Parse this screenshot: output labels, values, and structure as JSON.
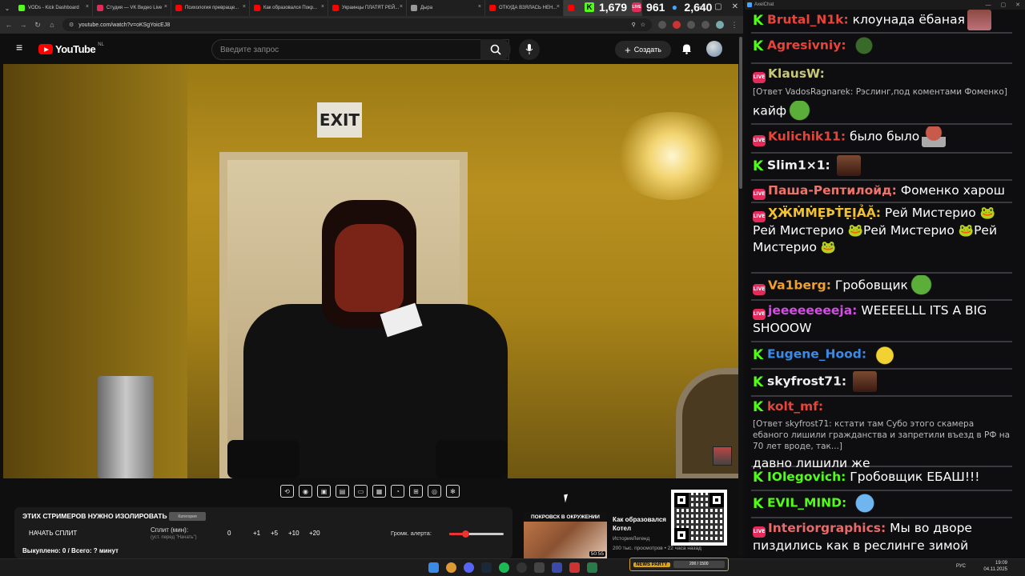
{
  "browser": {
    "tabs": [
      {
        "label": "VODs - Kick Dashboard",
        "color": "#53fc18",
        "active": false
      },
      {
        "label": "Студия — VK Видео Live",
        "color": "#e22b5b",
        "active": false
      },
      {
        "label": "Психология превраще...",
        "color": "#f00",
        "active": false
      },
      {
        "label": "Как образовался Покр...",
        "color": "#f00",
        "active": false
      },
      {
        "label": "Украинцы ПЛАТЯТ РЕЙ...",
        "color": "#f00",
        "active": false
      },
      {
        "label": "Дыра",
        "color": "#999",
        "active": false
      },
      {
        "label": "ОТКУДА ВЗЯЛАСЬ НЕН...",
        "color": "#f00",
        "active": false
      },
      {
        "label": "",
        "color": "#f00",
        "active": true
      }
    ],
    "url": "youtube.com/watch?v=oKSgYoicEJ8",
    "window_controls": [
      "—",
      "▢",
      "✕"
    ]
  },
  "stream_overlay": {
    "kick_viewers": "1,679",
    "vk_viewers": "961",
    "total_viewers": "2,640"
  },
  "youtube": {
    "logo_text": "YouTube",
    "region": "NL",
    "search_placeholder": "Введите запрос",
    "create_label": "Создать"
  },
  "video": {
    "exit_sign": "EXIT"
  },
  "player_toolbar": {
    "icons": [
      "loop-icon",
      "audio-icon",
      "screenshot-icon",
      "clapper-icon",
      "aspect-icon",
      "frame-icon",
      "speed-icon",
      "crop-icon",
      "camera-icon",
      "settings-icon"
    ]
  },
  "split_panel": {
    "title": "ЭТИХ СТРИМЕРОВ НУЖНО ИЗОЛИРОВАТЬ",
    "badge": "Категория",
    "start_label": "НАЧАТЬ СПЛИТ",
    "split_min_label": "Сплит (мин):",
    "split_hint": "(уст. перед \"Начать\")",
    "value": "0",
    "increments": [
      "+1",
      "+5",
      "+10",
      "+20"
    ],
    "volume_label": "Громк. алерта:",
    "volume_level": 0.3,
    "status": "Выкуплено: 0 / Всего: ? минут"
  },
  "recommended": {
    "thumb_title": "ПОКРОВСК В ОКРУЖЕНИИ",
    "duration": "50:55",
    "title": "Как образовался Котел",
    "channel": "ИсторияЛегенд",
    "meta": "200 тыс. просмотров • 22 часа назад"
  },
  "chat": {
    "window_title": "AxelChat",
    "messages": [
      {
        "platform": "kick",
        "user": "Brutal_N1k:",
        "color": "#e8443a",
        "text": "клоунада ёбаная",
        "emotes": [
          "e-mouth"
        ],
        "reply": ""
      },
      {
        "platform": "kick",
        "user": "Agresivniy:",
        "color": "#e8443a",
        "text": "",
        "emotes": [
          "e-frog"
        ],
        "reply": ""
      },
      {
        "platform": "vk",
        "user": "KlausW:",
        "color": "#c8c87a",
        "text": "кайф",
        "emotes": [
          "e-pepe"
        ],
        "reply": "[Ответ VadosRagnarek: Рэслинг,под коментами Фоменко]"
      },
      {
        "platform": "vk",
        "user": "Kulichik11:",
        "color": "#e8443a",
        "text": "было было",
        "emotes": [
          "e-mush"
        ],
        "reply": ""
      },
      {
        "platform": "kick",
        "user": "Slim1×1:",
        "color": "#f0f0f0",
        "text": "",
        "emotes": [
          "e-face"
        ],
        "reply": ""
      },
      {
        "platform": "vk",
        "user": "Паша-Рептилойд:",
        "color": "#f0736a",
        "text": "Фоменко харош",
        "emotes": [],
        "reply": ""
      },
      {
        "platform": "vk",
        "user": "ӼӜṀṀẸꝤṪẸỊẢẶ:",
        "color": "#f2c230",
        "text": "Рей Мистерио 🐸Рей Мистерио 🐸Рей Мистерио 🐸Рей Мистерио 🐸",
        "emotes": [],
        "reply": ""
      },
      {
        "platform": "vk",
        "user": "Va1berg:",
        "color": "#f0a030",
        "text": "Гробовщик",
        "emotes": [
          "e-pepe"
        ],
        "reply": ""
      },
      {
        "platform": "vk",
        "user": "jeeeeeeeeja:",
        "color": "#d050e0",
        "text": "WEEEELLL ITS A BIG SHOOOW",
        "emotes": [],
        "reply": ""
      },
      {
        "platform": "kick",
        "user": "Eugene_Hood:",
        "color": "#3a8ae8",
        "text": "",
        "emotes": [
          "e-yellow"
        ],
        "reply": ""
      },
      {
        "platform": "kick",
        "user": "skyfrost71:",
        "color": "#f0f0f0",
        "text": "",
        "emotes": [
          "e-face"
        ],
        "reply": ""
      },
      {
        "platform": "kick",
        "user": "kolt_mf:",
        "color": "#e8443a",
        "text": "давно лишили же",
        "emotes": [],
        "reply": "[Ответ skyfrost71: кстати там Субо этого скамера ебаного лишили гражданства и запретили въезд в РФ на 70 лет вроде, так...]"
      },
      {
        "platform": "kick",
        "user": "IOlegovich:",
        "color": "#53fc18",
        "text": "Гробовщик ЕБАШ!!!",
        "emotes": [],
        "reply": ""
      },
      {
        "platform": "kick",
        "user": "EVIL_MIND:",
        "color": "#53fc18",
        "text": "",
        "emotes": [
          "e-blue"
        ],
        "reply": ""
      },
      {
        "platform": "vk",
        "user": "Interiorgraphics:",
        "color": "#e86a6a",
        "text": "Мы во дворе пиздились как в реслинге зимой",
        "emotes": [],
        "reply": ""
      }
    ]
  },
  "taskbar": {
    "game_label": "NEWS PARTY",
    "game_progress": "200 / 1500",
    "lang": "РУС",
    "time": "19:09",
    "date": "04.11.2025"
  }
}
